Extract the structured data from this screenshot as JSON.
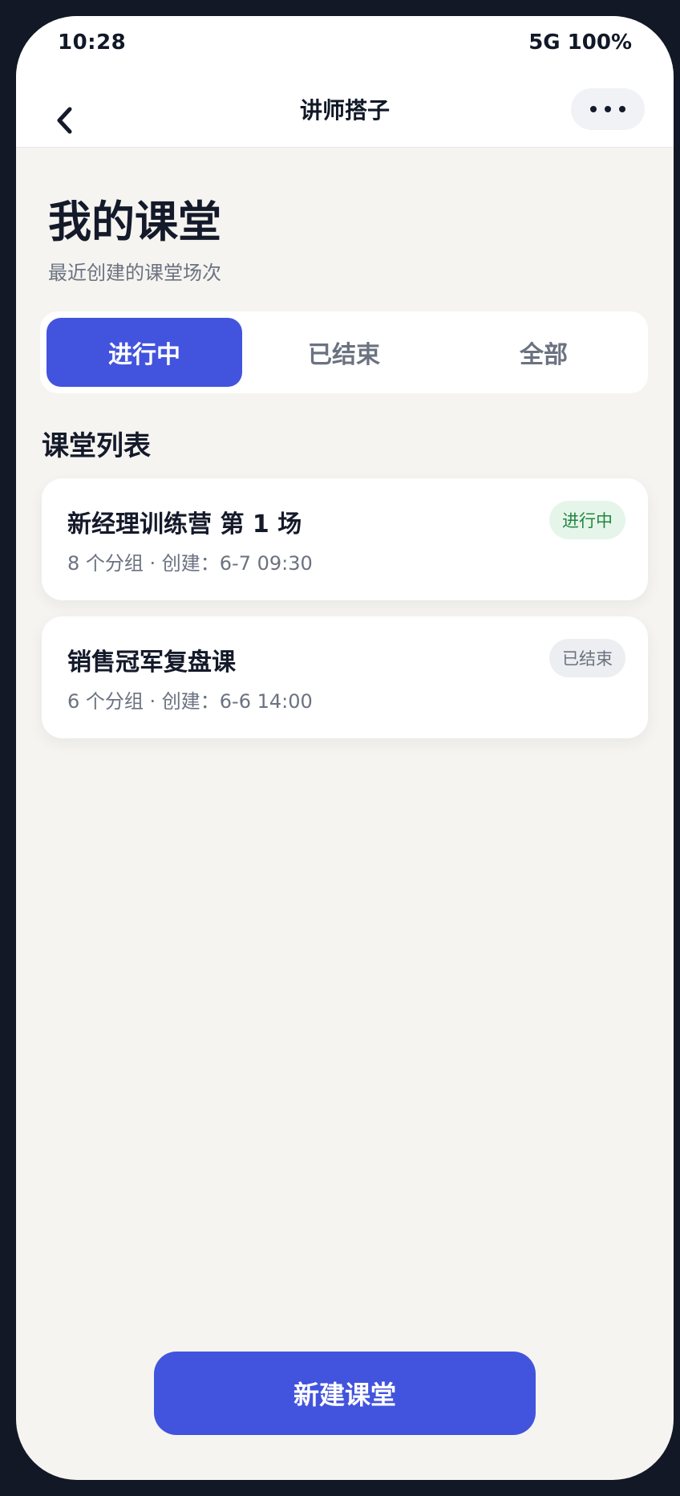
{
  "status_bar": {
    "time": "10:28",
    "network_battery": "5G 100%"
  },
  "nav": {
    "title": "讲师搭子",
    "back_icon": "chevron-left-icon",
    "more_icon": "more-horizontal-icon"
  },
  "header": {
    "title": "我的课堂",
    "subtitle": "最近创建的课堂场次"
  },
  "tabs": [
    {
      "label": "进行中",
      "active": true
    },
    {
      "label": "已结束",
      "active": false
    },
    {
      "label": "全部",
      "active": false
    }
  ],
  "section": {
    "title": "课堂列表"
  },
  "classes": [
    {
      "title": "新经理训练营 第 1 场",
      "meta": "8 个分组 · 创建：6-7 09:30",
      "status": "进行中"
    },
    {
      "title": "销售冠军复盘课",
      "meta": "6 个分组 · 创建：6-6 14:00",
      "status": "已结束"
    }
  ],
  "actions": {
    "new_label": "新建课堂"
  },
  "colors": {
    "accent": "#4254dd",
    "active_badge_bg": "#e6f5ea",
    "active_badge_text": "#22863f",
    "ended_badge_bg": "#eceef1",
    "background": "#f5f4f0"
  }
}
